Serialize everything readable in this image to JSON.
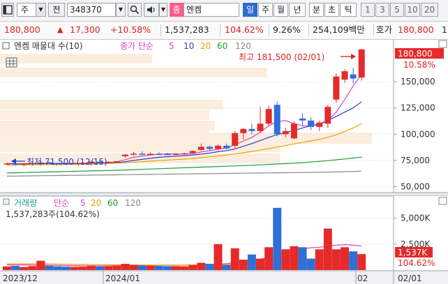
{
  "toolbar": {
    "type_label": "주",
    "prev_label": "전",
    "code": "348370",
    "stock_badge": "종",
    "stock_name": "엔켐",
    "periods": [
      {
        "label": "일",
        "active": true
      },
      {
        "label": "주",
        "active": false
      },
      {
        "label": "월",
        "active": false
      },
      {
        "label": "년",
        "active": false
      },
      {
        "label": "분",
        "active": false
      },
      {
        "label": "초",
        "active": false
      },
      {
        "label": "틱",
        "active": false
      }
    ],
    "intervals": [
      "1",
      "3",
      "5",
      "10",
      "20"
    ]
  },
  "quote": {
    "price": "180,800",
    "change_arrow": "▲",
    "change": "17,300",
    "change_pct": "+10.58%",
    "volume": "1,537,283",
    "volume_ratio": "104.62%",
    "turnover": "9.26%",
    "amount": "254,109백만",
    "ask_label": "호가",
    "ask_price": "180,800",
    "ask_trunc": "1"
  },
  "price_panel": {
    "legend": {
      "name": "엔켐 매물대 수(10)",
      "ma_label": "종가 단순",
      "periods": [
        {
          "p": "5",
          "color": "#e040c0"
        },
        {
          "p": "10",
          "color": "#2a3fc0"
        },
        {
          "p": "20",
          "color": "#f0a000"
        },
        {
          "p": "60",
          "color": "#1a9a3a"
        },
        {
          "p": "120",
          "color": "#888888"
        }
      ]
    },
    "high_annotation": "최고 181,500 (02/01)",
    "low_annotation": "최저 71,500 (12/15)",
    "last_price_label": "180,800",
    "last_pct_label": "10.58%",
    "y_axis_labels": [
      "150,000",
      "125,000",
      "100,000",
      "75,000",
      "50,000"
    ]
  },
  "volume_panel": {
    "legend": {
      "name": "거래량",
      "ma_label": "단순",
      "periods": [
        {
          "p": "5",
          "color": "#e040c0"
        },
        {
          "p": "20",
          "color": "#f0a000"
        },
        {
          "p": "60",
          "color": "#1a9a3a"
        },
        {
          "p": "120",
          "color": "#888888"
        }
      ]
    },
    "current": "1,537,283주(104.62%)",
    "last_label": "1,537K",
    "last_pct_label": "104.62%",
    "y_axis_labels": [
      "5,000K",
      "2,500K"
    ]
  },
  "x_axis": {
    "labels": [
      "2023/12",
      "2024/01",
      "02"
    ],
    "right_label": "02/01"
  },
  "colors": {
    "up": "#e62a2a",
    "down": "#2f6fd6",
    "ma5": "#e040c0",
    "ma10": "#2a3fc0",
    "ma20": "#f0a000",
    "ma60": "#1a9a3a",
    "ma120": "#888888"
  },
  "chart_data": {
    "type": "candlestick",
    "price_range": [
      45000,
      190000
    ],
    "volume_range_k": [
      0,
      7000
    ],
    "candles": [
      {
        "o": 71000,
        "h": 73000,
        "l": 70500,
        "c": 72000,
        "v": 350
      },
      {
        "o": 72000,
        "h": 73500,
        "l": 70000,
        "c": 71000,
        "v": 400
      },
      {
        "o": 71000,
        "h": 72500,
        "l": 69500,
        "c": 72000,
        "v": 300
      },
      {
        "o": 72000,
        "h": 74000,
        "l": 71500,
        "c": 72500,
        "v": 380
      },
      {
        "o": 72500,
        "h": 74500,
        "l": 71500,
        "c": 73000,
        "v": 900
      },
      {
        "o": 73000,
        "h": 74000,
        "l": 71800,
        "c": 72400,
        "v": 420
      },
      {
        "o": 72400,
        "h": 73000,
        "l": 71500,
        "c": 72000,
        "v": 360
      },
      {
        "o": 72000,
        "h": 72600,
        "l": 70800,
        "c": 71500,
        "v": 330
      },
      {
        "o": 71500,
        "h": 72800,
        "l": 71000,
        "c": 72600,
        "v": 310
      },
      {
        "o": 72600,
        "h": 73600,
        "l": 72000,
        "c": 72800,
        "v": 330
      },
      {
        "o": 72800,
        "h": 74500,
        "l": 72400,
        "c": 73800,
        "v": 380
      },
      {
        "o": 73800,
        "h": 74500,
        "l": 72800,
        "c": 73200,
        "v": 340
      },
      {
        "o": 73200,
        "h": 74200,
        "l": 72600,
        "c": 73600,
        "v": 360
      },
      {
        "o": 73600,
        "h": 74600,
        "l": 73000,
        "c": 74200,
        "v": 420
      },
      {
        "o": 79000,
        "h": 81000,
        "l": 77500,
        "c": 80500,
        "v": 600
      },
      {
        "o": 80500,
        "h": 83000,
        "l": 79500,
        "c": 81500,
        "v": 480
      },
      {
        "o": 81500,
        "h": 83500,
        "l": 79500,
        "c": 80500,
        "v": 450
      },
      {
        "o": 80500,
        "h": 82500,
        "l": 79800,
        "c": 81300,
        "v": 420
      },
      {
        "o": 81300,
        "h": 83000,
        "l": 80000,
        "c": 81000,
        "v": 400
      },
      {
        "o": 81000,
        "h": 82500,
        "l": 80000,
        "c": 80800,
        "v": 380
      },
      {
        "o": 80800,
        "h": 82000,
        "l": 79800,
        "c": 81200,
        "v": 380
      },
      {
        "o": 81200,
        "h": 82500,
        "l": 80500,
        "c": 81800,
        "v": 360
      },
      {
        "o": 82000,
        "h": 84500,
        "l": 81500,
        "c": 84000,
        "v": 480
      },
      {
        "o": 85000,
        "h": 91000,
        "l": 84000,
        "c": 88000,
        "v": 700
      },
      {
        "o": 88000,
        "h": 89500,
        "l": 84000,
        "c": 86000,
        "v": 600
      },
      {
        "o": 86000,
        "h": 90500,
        "l": 84500,
        "c": 89000,
        "v": 2500
      },
      {
        "o": 89000,
        "h": 91000,
        "l": 85500,
        "c": 86500,
        "v": 500
      },
      {
        "o": 89000,
        "h": 103000,
        "l": 87000,
        "c": 101000,
        "v": 2100
      },
      {
        "o": 101000,
        "h": 106000,
        "l": 95000,
        "c": 105000,
        "v": 1000
      },
      {
        "o": 105000,
        "h": 110000,
        "l": 100000,
        "c": 103000,
        "v": 1500
      },
      {
        "o": 103000,
        "h": 126000,
        "l": 101000,
        "c": 110000,
        "v": 1100
      },
      {
        "o": 110000,
        "h": 127000,
        "l": 108000,
        "c": 124000,
        "v": 2200
      },
      {
        "o": 128000,
        "h": 131000,
        "l": 98000,
        "c": 100000,
        "v": 6000
      },
      {
        "o": 100000,
        "h": 106000,
        "l": 97000,
        "c": 103000,
        "v": 2000
      },
      {
        "o": 96000,
        "h": 112000,
        "l": 95000,
        "c": 110000,
        "v": 2300
      },
      {
        "o": 115000,
        "h": 120000,
        "l": 108000,
        "c": 113000,
        "v": 2200
      },
      {
        "o": 113000,
        "h": 116000,
        "l": 104000,
        "c": 107000,
        "v": 1100
      },
      {
        "o": 107000,
        "h": 113000,
        "l": 103000,
        "c": 111000,
        "v": 2000
      },
      {
        "o": 110000,
        "h": 128000,
        "l": 106000,
        "c": 126000,
        "v": 4000
      },
      {
        "o": 133000,
        "h": 158000,
        "l": 130000,
        "c": 155000,
        "v": 2000
      },
      {
        "o": 152000,
        "h": 162000,
        "l": 149000,
        "c": 160000,
        "v": 2200
      },
      {
        "o": 157000,
        "h": 163000,
        "l": 148000,
        "c": 153000,
        "v": 1800
      },
      {
        "o": 154000,
        "h": 181500,
        "l": 151000,
        "c": 180800,
        "v": 1537
      }
    ],
    "ma": {
      "5": [
        72000,
        72000,
        71600,
        71800,
        72100,
        72200,
        72200,
        72100,
        72100,
        72300,
        72500,
        72700,
        73000,
        73600,
        75700,
        78000,
        79200,
        80200,
        81000,
        81300,
        81200,
        81200,
        81500,
        83000,
        84400,
        85700,
        86900,
        90000,
        93500,
        97000,
        102000,
        108000,
        112000,
        113000,
        110000,
        108000,
        108000,
        109500,
        113000,
        121000,
        133000,
        146000,
        157000
      ],
      "10": [
        71800,
        71800,
        71800,
        71800,
        71900,
        72000,
        72000,
        72000,
        72000,
        72100,
        72200,
        72300,
        72500,
        72800,
        73800,
        75000,
        76000,
        77000,
        78000,
        78500,
        79000,
        79500,
        80200,
        81000,
        82000,
        83300,
        84400,
        86000,
        88500,
        91000,
        94000,
        97000,
        99500,
        101500,
        103500,
        106000,
        108000,
        110000,
        113000,
        117000,
        121000,
        125000,
        131000
      ],
      "20": [
        70500,
        70600,
        70700,
        70800,
        70900,
        71000,
        71100,
        71200,
        71300,
        71400,
        71600,
        71800,
        72000,
        72400,
        72800,
        73300,
        73800,
        74300,
        74800,
        75300,
        75800,
        76300,
        76900,
        77600,
        78400,
        79300,
        80200,
        81200,
        82300,
        83500,
        84800,
        86200,
        87700,
        89300,
        90700,
        92100,
        93600,
        95100,
        97000,
        99500,
        102500,
        106000,
        110000
      ],
      "60": [
        63000,
        63200,
        63400,
        63600,
        63800,
        64000,
        64200,
        64400,
        64600,
        64800,
        65000,
        65200,
        65400,
        65600,
        65900,
        66200,
        66500,
        66800,
        67100,
        67400,
        67700,
        68000,
        68300,
        68600,
        68900,
        69200,
        69500,
        69800,
        70100,
        70400,
        70800,
        71200,
        71600,
        72000,
        72400,
        72900,
        73500,
        74100,
        74800,
        75600,
        76400,
        77300,
        78200
      ],
      "120": [
        60000,
        60100,
        60200,
        60300,
        60400,
        60500,
        60600,
        60700,
        60800,
        60900,
        61000,
        61100,
        61200,
        61300,
        61400,
        61500,
        61600,
        61700,
        61800,
        61900,
        62000,
        62100,
        62200,
        62300,
        62400,
        62500,
        62600,
        62700,
        62800,
        62900,
        63000,
        63100,
        63200,
        63300,
        63400,
        63500,
        63600,
        63700,
        63800,
        64000,
        64200,
        64500,
        64800
      ]
    },
    "vol_ma_k": {
      "5": [
        500,
        500,
        500,
        480,
        470,
        460,
        450,
        440,
        430,
        420,
        410,
        400,
        400,
        410,
        420,
        430,
        440,
        450,
        460,
        470,
        470,
        470,
        480,
        500,
        520,
        560,
        620,
        700,
        800,
        900,
        1050,
        1200,
        1450,
        1700,
        1900,
        2050,
        2150,
        2200,
        2300,
        2400,
        2450,
        2400,
        2300
      ],
      "20": [
        600,
        600,
        600,
        600,
        590,
        580,
        570,
        560,
        550,
        540,
        530,
        520,
        510,
        500,
        495,
        490,
        485,
        480,
        480,
        480,
        480,
        480,
        490,
        500,
        510,
        520,
        540,
        560,
        600,
        650,
        700,
        760,
        820,
        880,
        940,
        1000,
        1050,
        1100,
        1150,
        1200,
        1250,
        1280,
        1300
      ]
    }
  }
}
